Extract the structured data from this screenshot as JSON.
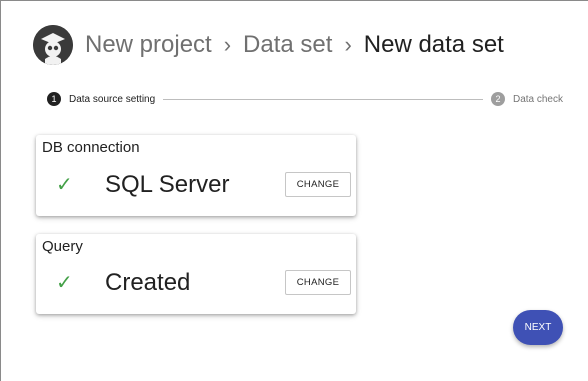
{
  "breadcrumb": {
    "items": [
      "New project",
      "Data set",
      "New data set"
    ],
    "separator": "›"
  },
  "stepper": {
    "steps": [
      {
        "number": "1",
        "label": "Data source setting",
        "state": "active"
      },
      {
        "number": "2",
        "label": "Data check",
        "state": "inactive"
      }
    ]
  },
  "cards": {
    "db_connection": {
      "title": "DB connection",
      "value": "SQL Server",
      "status_icon": "check-icon",
      "button_label": "CHANGE"
    },
    "query": {
      "title": "Query",
      "value": "Created",
      "status_icon": "check-icon",
      "button_label": "CHANGE"
    }
  },
  "actions": {
    "next_label": "NEXT"
  },
  "colors": {
    "accent": "#3f51b5",
    "success": "#43a047"
  }
}
